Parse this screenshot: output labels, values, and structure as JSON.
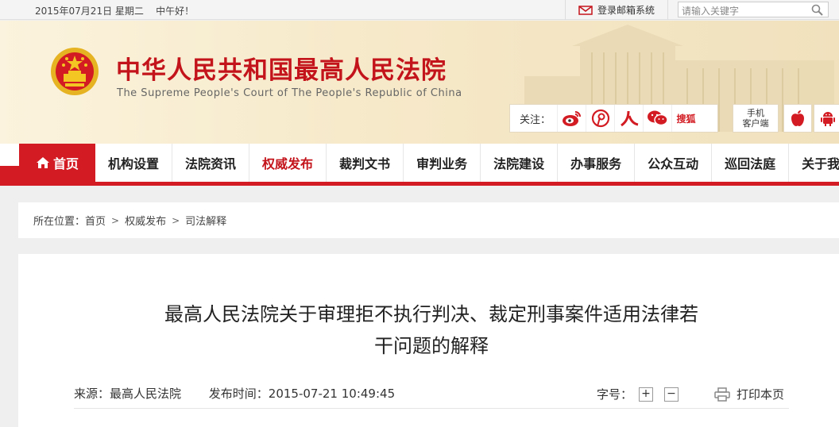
{
  "topbar": {
    "date_text": "2015年07月21日 星期二",
    "greeting": "中午好！",
    "mail_label": "登录邮箱系统",
    "search_placeholder": "请输入关键字"
  },
  "header": {
    "title": "中华人民共和国最高人民法院",
    "subtitle": "The Supreme People's Court of The People's Republic of China",
    "follow_label": "关注：",
    "social": [
      "weibo-icon",
      "pinterest-icon",
      "renren-icon",
      "wechat-icon",
      "sohu-icon"
    ],
    "sohu_label": "搜狐",
    "mobile_label_1": "手机",
    "mobile_label_2": "客户端"
  },
  "nav": {
    "items": [
      {
        "label": "首页"
      },
      {
        "label": "机构设置"
      },
      {
        "label": "法院资讯"
      },
      {
        "label": "权威发布"
      },
      {
        "label": "裁判文书"
      },
      {
        "label": "审判业务"
      },
      {
        "label": "法院建设"
      },
      {
        "label": "办事服务"
      },
      {
        "label": "公众互动"
      },
      {
        "label": "巡回法庭"
      },
      {
        "label": "关于我们"
      }
    ],
    "active_index": 3
  },
  "breadcrumb": {
    "prefix": "所在位置：",
    "items": [
      "首页",
      "权威发布",
      "司法解释"
    ]
  },
  "article": {
    "title_line_1": "最高人民法院关于审理拒不执行判决、裁定刑事案件适用法律若",
    "title_line_2": "干问题的解释",
    "source": "来源：最高人民法院",
    "published": "发布时间：2015-07-21 10:49:45",
    "font_size_label": "字号：",
    "increase_label": "+",
    "decrease_label": "−",
    "print_label": "打印本页"
  },
  "colors": {
    "brand_red": "#d21b22",
    "title_red": "#c4141b",
    "header_bg": "#f6e9c9"
  }
}
